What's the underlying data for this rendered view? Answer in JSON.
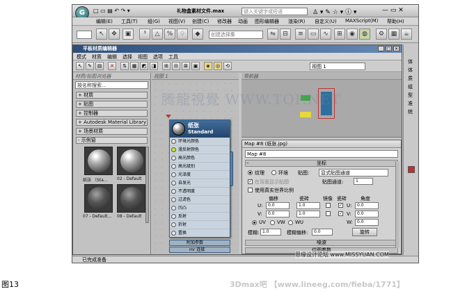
{
  "app": {
    "title": "礼物盒素材文件.max",
    "search_placeholder": "键入关键字或短语",
    "menu": [
      "编辑(E)",
      "工具(T)",
      "组(G)",
      "视图(V)",
      "创建(C)",
      "修改器",
      "动画",
      "图形编辑器",
      "渲染(R)",
      "自定义(U)",
      "MAXScript(M)",
      "帮助(H)"
    ],
    "selection_set": "创建选择集",
    "status": "已完成准备"
  },
  "slate": {
    "title": "平板材质编辑器",
    "menu": [
      "模式",
      "材质",
      "编辑",
      "选择",
      "视图",
      "选项",
      "工具"
    ],
    "view_select": "视图 1",
    "browser_title": "材质/贴图浏览器",
    "view_title": "视图 1",
    "nav_title": "导航器",
    "search_placeholder": "按名称搜索...",
    "rollouts": [
      "+ 材质",
      "+ 贴图",
      "+ 控制器",
      "+ Autodesk Material Library",
      "+ 场景材质",
      "- 示例窗"
    ],
    "samples": [
      {
        "caption": "纸张 （Sta..."
      },
      {
        "caption": "02 - Default"
      },
      {
        "caption": "07 - Default..."
      },
      {
        "caption": "08 - Default"
      }
    ],
    "node": {
      "name": "纸张",
      "type": "Standard",
      "slots": [
        "环境光颜色",
        "漫反射颜色",
        "高光颜色",
        "高光级别",
        "光泽度",
        "自发光",
        "不透明度",
        "过滤色",
        "凹凸",
        "反射",
        "折射",
        "置换"
      ],
      "footer1": "附加参数",
      "footer2": "mr 连接"
    }
  },
  "params": {
    "title": "Map #8 (纸张.jpg)",
    "name_value": "Map #8",
    "section": "坐标",
    "radio_texture": "纹理",
    "radio_env": "环境",
    "map_label": "贴图:",
    "map_value": "显式贴图通道",
    "checkbox_show_back": "在背面显示贴图",
    "map_channel_label": "贴图通道:",
    "map_channel_value": "1",
    "checkbox_real_world": "使用真实世界比例",
    "col_offset": "偏移",
    "col_tiling": "瓷砖",
    "col_mirror": "镜像",
    "col_tile": "瓷砖",
    "col_angle": "角度",
    "u_label": "U:",
    "v_label": "V:",
    "w_label": "W:",
    "u_offset": "0.0",
    "v_offset": "0.0",
    "u_tiling": "1.0",
    "v_tiling": "1.0",
    "u_angle": "0.0",
    "v_angle": "0.0",
    "w_angle": "0.0",
    "uvw": [
      "UV",
      "VW",
      "WU"
    ],
    "blur_label": "模糊:",
    "blur_value": "1.0",
    "blur_offset_label": "模糊偏移:",
    "blur_offset_value": "0.0",
    "rotate_label": "旋转",
    "noise_rollout": "噪波",
    "bitmap_rollout": "位图参数"
  },
  "right_panel": [
    "体",
    "体",
    "质",
    "组",
    "型",
    "准",
    "统"
  ],
  "caption": "图13",
  "footer": "3Dmax吧 【www.lineeg.com/fieba/1771】",
  "watermark": "思缘设计论坛  www.MISSYUAN.COM",
  "watermark2": "腾龍視覺  WWW.TOP.NET",
  "colors": {
    "title_blue": "#2c4f7c",
    "node_blue": "#23466d",
    "accent_red": "#c03030"
  }
}
